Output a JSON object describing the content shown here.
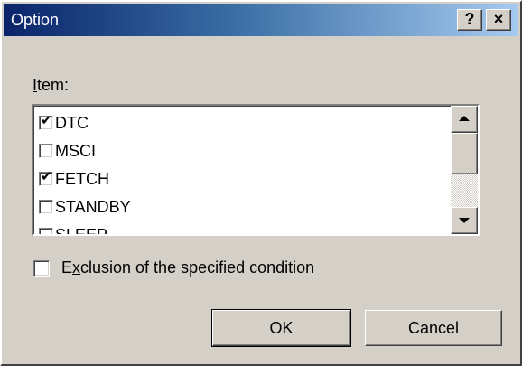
{
  "window": {
    "title": "Option",
    "help_label": "?",
    "close_label": "×"
  },
  "item_list": {
    "label_mnemonic": "I",
    "label_rest": "tem:",
    "items": [
      {
        "label": "DTC",
        "checked": true
      },
      {
        "label": "MSCI",
        "checked": false
      },
      {
        "label": "FETCH",
        "checked": true
      },
      {
        "label": "STANDBY",
        "checked": false
      },
      {
        "label": "SLEEP",
        "checked": false
      }
    ],
    "check_glyph": "✔"
  },
  "exclusion": {
    "label_pre": "E",
    "label_mnemonic": "x",
    "label_rest": "clusion of the specified condition",
    "checked": false
  },
  "buttons": {
    "ok_label": "OK",
    "cancel_label": "Cancel"
  },
  "colors": {
    "title_gradient_start": "#0a246a",
    "title_gradient_end": "#a6caf0",
    "face": "#d4d0c8"
  },
  "icons": {
    "scroll_up": "arrow-up-icon",
    "scroll_down": "arrow-down-icon"
  }
}
